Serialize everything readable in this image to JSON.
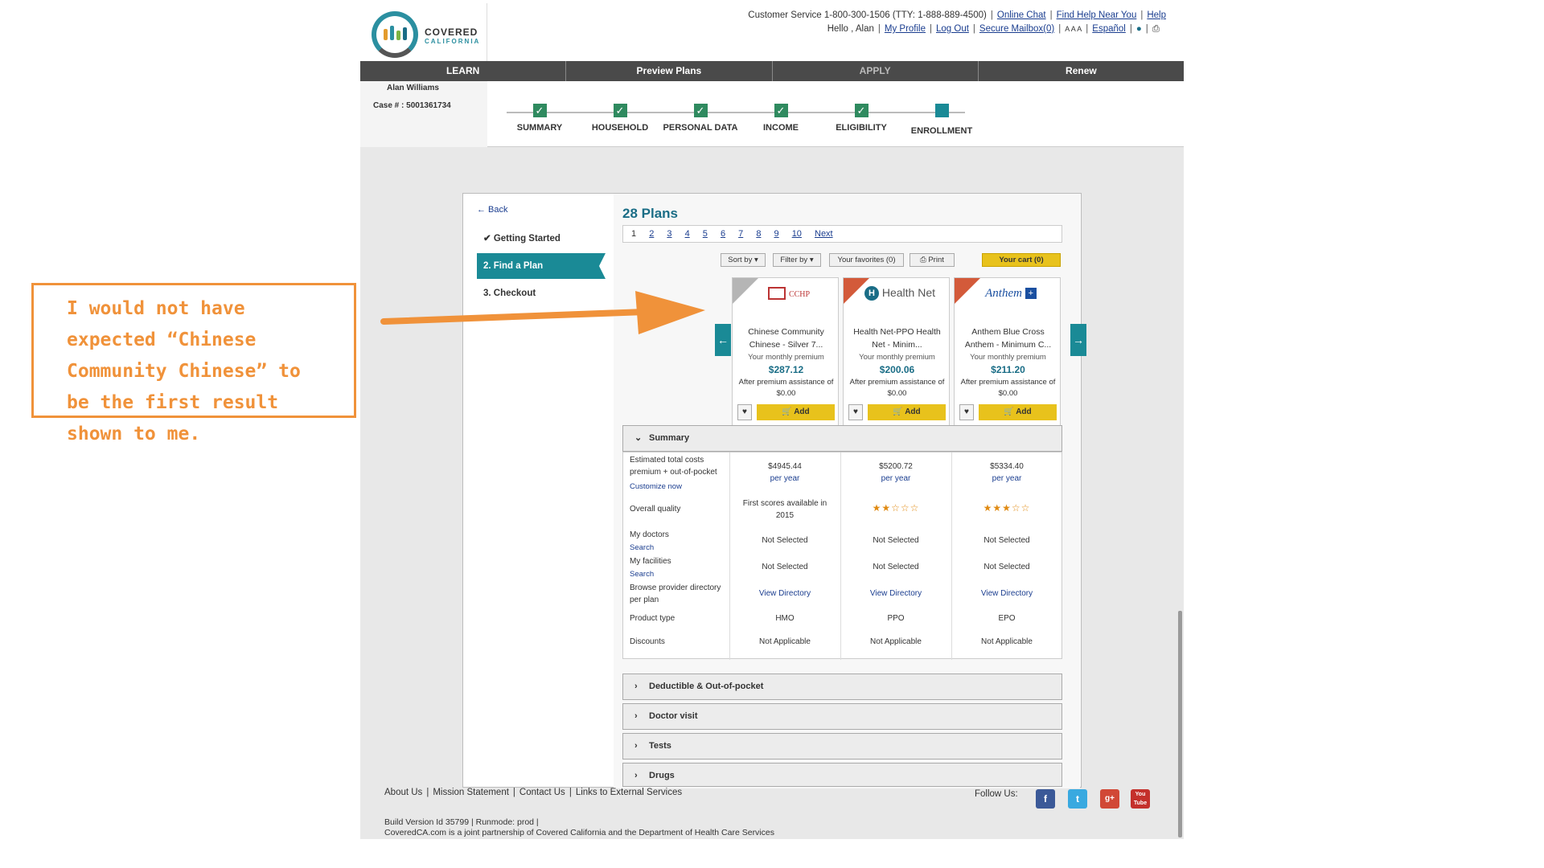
{
  "header": {
    "logo_line1": "COVERED",
    "logo_line2": "CALIFORNIA",
    "customer_service": "Customer Service 1-800-300-1506 (TTY: 1-888-889-4500)",
    "online_chat": "Online Chat",
    "find_help": "Find Help Near You",
    "help": "Help",
    "hello": "Hello , Alan",
    "my_profile": "My Profile",
    "log_out": "Log Out",
    "secure_mailbox": "Secure Mailbox(0)",
    "font_size": "A A A",
    "espanol": "Español",
    "globe_icon": "globe-icon",
    "print_icon": "print-icon"
  },
  "nav": [
    "LEARN",
    "Preview Plans",
    "APPLY",
    "Renew"
  ],
  "user": {
    "name": "Alan Williams",
    "case": "Case # : 5001361734"
  },
  "steps": [
    "SUMMARY",
    "HOUSEHOLD",
    "PERSONAL DATA",
    "INCOME",
    "ELIGIBILITY",
    "ENROLLMENT"
  ],
  "sidebar": {
    "back": "← Back",
    "items": [
      "Getting Started",
      "2.  Find a Plan",
      "3.  Checkout"
    ]
  },
  "plans": {
    "title": "28 Plans",
    "pages": [
      "1",
      "2",
      "3",
      "4",
      "5",
      "6",
      "7",
      "8",
      "9",
      "10",
      "Next"
    ],
    "toolbar": {
      "sort": "Sort by ▾",
      "filter": "Filter by ▾",
      "favorites": "Your favorites (0)",
      "print": "Print",
      "cart": "Your cart (0)"
    },
    "cards": [
      {
        "logo": "CCHP",
        "name": "Chinese Community Chinese - Silver 7...",
        "premium_label": "Your monthly premium",
        "price": "$287.12",
        "after": "After premium assistance of $0.00",
        "add": "Add"
      },
      {
        "logo": "Health Net",
        "name": "Health Net-PPO Health Net - Minim...",
        "premium_label": "Your monthly premium",
        "price": "$200.06",
        "after": "After premium assistance of $0.00",
        "add": "Add"
      },
      {
        "logo": "Anthem",
        "name": "Anthem Blue Cross Anthem - Minimum C...",
        "premium_label": "Your monthly premium",
        "price": "$211.20",
        "after": "After premium assistance of $0.00",
        "add": "Add"
      }
    ]
  },
  "summary": {
    "header": "Summary",
    "rows": {
      "total_costs": "Estimated total costs premium + out-of-pocket",
      "customize": "Customize now",
      "quality": "Overall quality",
      "doctors": "My doctors",
      "doctors_search": "Search",
      "facilities": "My facilities",
      "facilities_search": "Search",
      "browse": "Browse provider directory per plan",
      "product_type": "Product type",
      "discounts": "Discounts"
    },
    "values": [
      {
        "cost": "$4945.44",
        "per": "per year",
        "quality": "First scores available in 2015",
        "stars": "",
        "doctors": "Not Selected",
        "facilities": "Not Selected",
        "directory": "View Directory",
        "type": "HMO",
        "discounts": "Not Applicable"
      },
      {
        "cost": "$5200.72",
        "per": "per year",
        "quality": "",
        "stars": "★★☆☆☆",
        "doctors": "Not Selected",
        "facilities": "Not Selected",
        "directory": "View Directory",
        "type": "PPO",
        "discounts": "Not Applicable"
      },
      {
        "cost": "$5334.40",
        "per": "per year",
        "quality": "",
        "stars": "★★★☆☆",
        "doctors": "Not Selected",
        "facilities": "Not Selected",
        "directory": "View Directory",
        "type": "EPO",
        "discounts": "Not Applicable"
      }
    ]
  },
  "accordions": [
    "Deductible & Out-of-pocket",
    "Doctor visit",
    "Tests",
    "Drugs"
  ],
  "footer": {
    "links": [
      "About Us",
      "Mission Statement",
      "Contact Us",
      "Links to External Services"
    ],
    "follow": "Follow Us:",
    "social": [
      "f",
      "t",
      "g+",
      "You Tube"
    ],
    "build": "Build Version Id 35799  |   Runmode: prod  |",
    "partner": "CoveredCA.com is a joint partnership of Covered California and the Department of Health Care Services"
  },
  "annotation": "I would not have expected “Chinese Community Chinese” to be the first result shown to me.",
  "colors": {
    "teal": "#1a8a96",
    "annotation": "#f0923a",
    "cart": "#e8c21c",
    "nav": "#4a4a4a"
  }
}
